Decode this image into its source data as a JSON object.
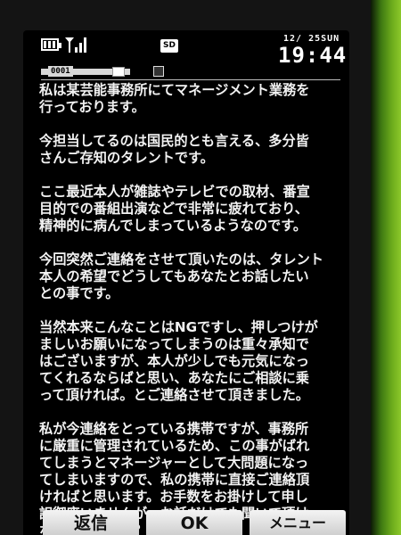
{
  "status": {
    "date": "12/ 25SUN",
    "time": "19:44",
    "sd_label": "SD",
    "icons": [
      "battery-icon",
      "signal-icon",
      "sd-card-icon"
    ]
  },
  "header": {
    "message_number": "0001",
    "icons": [
      "mail-icon",
      "attachment-icon"
    ]
  },
  "message": {
    "paragraphs": [
      "私は某芸能事務所にてマネージメント業務を\n行っております。",
      "今担当してるのは国民的とも言える、多分皆\nさんご存知のタレントです。",
      "ここ最近本人が雑誌やテレビでの取材、番宣\n目的での番組出演などで非常に疲れており、\n精神的に病んでしまっているようなのです。",
      "今回突然ご連絡をさせて頂いたのは、タレント\n本人の希望でどうしてもあなたとお話したい\nとの事です。",
      "当然本来こんなことはNGですし、押しつけが\nましいお願いになってしまうのは重々承知で\nはございますが、本人が少しでも元気になっ\nてくれるならばと思い、あなたにご相談に乗\nって頂ければ。とご連絡させて頂きました。",
      "私が今連絡をとっている携帯ですが、事務所\nに厳重に管理されているため、この事がばれ\nてしまうとマネージャーとして大問題になっ\nてしまいますので、私の携帯に直接ご連絡頂\nければと思います。お手数をお掛けして申し\n訳御座いませんが、お話だけでも聞いて頂け\nないでしょうか？"
    ]
  },
  "softkeys": {
    "left": "返信",
    "center": "OK",
    "right": "メニュー"
  }
}
